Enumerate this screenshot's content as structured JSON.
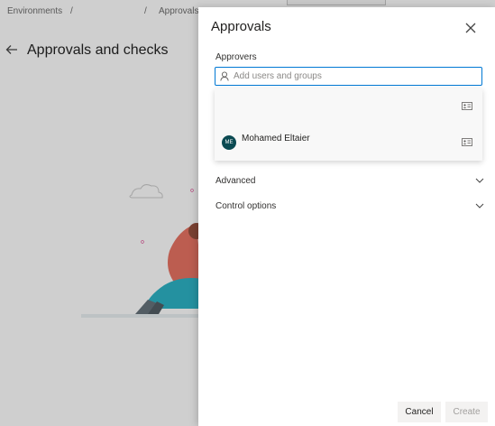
{
  "background": {
    "breadcrumb": {
      "item1": "Environments",
      "separator": "/",
      "item2": "Approvals"
    },
    "title": "Approvals and checks",
    "icons": {
      "back": "arrow-left-icon"
    }
  },
  "panel": {
    "title": "Approvals",
    "close_icon": "close-icon",
    "approvers": {
      "label": "Approvers",
      "placeholder": "Add users and groups",
      "search_icon": "person-icon"
    },
    "suggestions": [
      {
        "name": "",
        "icon": "contact-card-icon"
      },
      {
        "initials": "ME",
        "name": "Mohamed Eltaier",
        "icon": "contact-card-icon",
        "avatar_color": "#0b4a52"
      }
    ],
    "sections": [
      {
        "label": "Advanced",
        "icon": "chevron-down-icon"
      },
      {
        "label": "Control options",
        "icon": "chevron-down-icon"
      }
    ],
    "buttons": {
      "cancel": "Cancel",
      "create": "Create"
    }
  },
  "colors": {
    "accent": "#0078d4",
    "avatar": "#0b4a52"
  }
}
